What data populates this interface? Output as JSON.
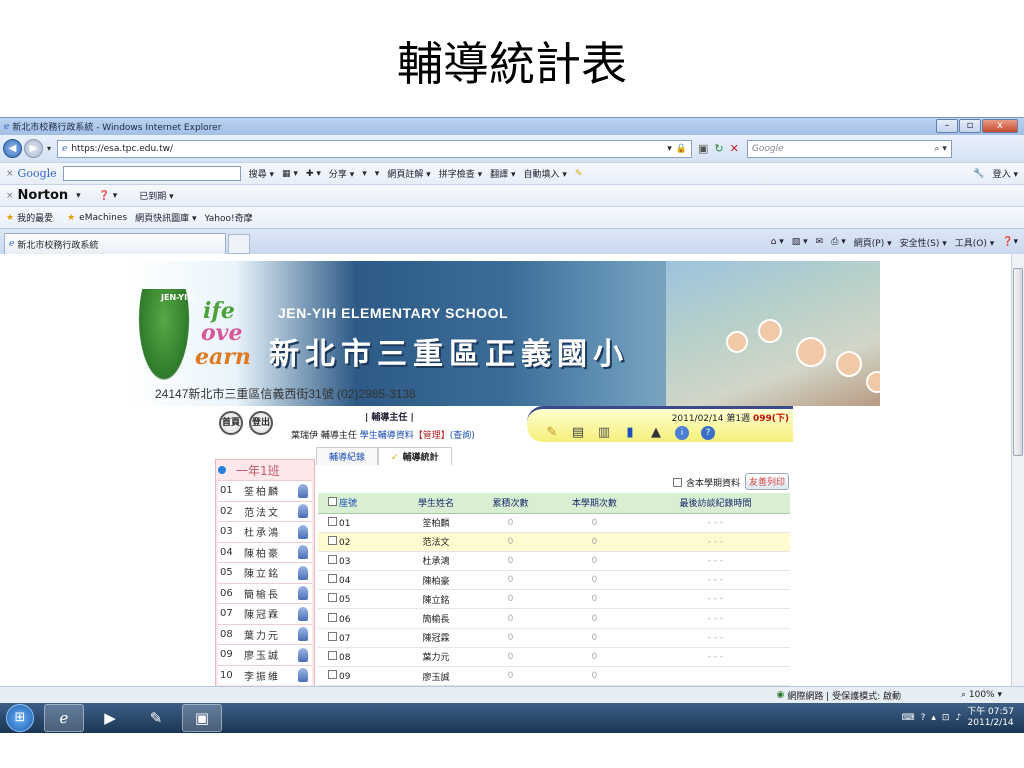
{
  "slide_title": "輔導統計表",
  "window": {
    "title": "新北市校務行政系統 - Windows Internet Explorer",
    "controls": [
      "–",
      "▫",
      "x"
    ]
  },
  "address": {
    "url": "https://esa.tpc.edu.tw/",
    "search_placeholder": "Google"
  },
  "google_toolbar": {
    "label": "Google",
    "items": [
      "搜尋 ▾",
      "▦ ▾",
      "✚ ▾",
      "分享 ▾",
      "▾",
      "▾",
      "網頁註解 ▾",
      "拼字檢查 ▾",
      "翻譯 ▾",
      "自動填入 ▾"
    ],
    "login": "登入 ▾"
  },
  "norton_toolbar": {
    "label": "Norton",
    "expired": "已到期 ▾"
  },
  "favorites": {
    "items": [
      "我的最愛",
      "eMachines",
      "網頁快訊圖庫 ▾",
      "Yahoo!奇摩"
    ]
  },
  "tab": {
    "title": "新北市校務行政系統"
  },
  "commands": [
    "▾",
    "▾",
    "▾",
    "網頁(P) ▾",
    "安全性(S) ▾",
    "工具(O) ▾",
    "▾"
  ],
  "banner": {
    "jen_yih": "JEN-YIH",
    "life_words": [
      "ife",
      "ove",
      "earn"
    ],
    "school_en": "JEN-YIH ELEMENTARY SCHOOL",
    "school_zh": "新北市三重區正義國小",
    "address": "24147新北市三重區信義西街31號 (02)2985-3138"
  },
  "header": {
    "home": "首頁",
    "logout": "登出",
    "role": "| 輔導主任 |",
    "user_prefix": "葉瑞伊 輔導主任",
    "link_data": "學生輔導資料",
    "link_manage": "【管理】",
    "link_query": "(查詢)",
    "date": "2011/02/14 第1週",
    "week": "099(下)"
  },
  "tabs": {
    "record": "輔導紀錄",
    "check": "✓",
    "stats": "輔導統計"
  },
  "class_list": {
    "title": "一年1班",
    "students": [
      {
        "no": "01",
        "name": "筌柏麟"
      },
      {
        "no": "02",
        "name": "范法文"
      },
      {
        "no": "03",
        "name": "杜承鴻"
      },
      {
        "no": "04",
        "name": "陳柏豪"
      },
      {
        "no": "05",
        "name": "陳立銘"
      },
      {
        "no": "06",
        "name": "簡榆長"
      },
      {
        "no": "07",
        "name": "陳冠霖"
      },
      {
        "no": "08",
        "name": "葉力元"
      },
      {
        "no": "09",
        "name": "廖玉誠"
      },
      {
        "no": "10",
        "name": "李振維"
      }
    ]
  },
  "table": {
    "semester_label": "含本學期資料",
    "print_label": "友善列印",
    "headers": [
      "座號",
      "學生姓名",
      "累積次數",
      "本學期次數",
      "最後訪談紀錄時間"
    ],
    "rows": [
      {
        "seat": "01",
        "name": "筌柏麟",
        "total": "0",
        "term": "0",
        "last": "- - -"
      },
      {
        "seat": "02",
        "name": "范法文",
        "total": "0",
        "term": "0",
        "last": "- - -"
      },
      {
        "seat": "03",
        "name": "杜承鴻",
        "total": "0",
        "term": "0",
        "last": "- - -"
      },
      {
        "seat": "04",
        "name": "陳柏豪",
        "total": "0",
        "term": "0",
        "last": "- - -"
      },
      {
        "seat": "05",
        "name": "陳立銘",
        "total": "0",
        "term": "0",
        "last": "- - -"
      },
      {
        "seat": "06",
        "name": "簡榆長",
        "total": "0",
        "term": "0",
        "last": "- - -"
      },
      {
        "seat": "07",
        "name": "陳冠霖",
        "total": "0",
        "term": "0",
        "last": "- - -"
      },
      {
        "seat": "08",
        "name": "葉力元",
        "total": "0",
        "term": "0",
        "last": "- - -"
      },
      {
        "seat": "09",
        "name": "廖玉誠",
        "total": "0",
        "term": "0",
        "last": ""
      }
    ]
  },
  "status": {
    "zone": "網際網路 | 受保護模式: 啟動",
    "zoom": "100%"
  },
  "clock": {
    "time": "下午 07:57",
    "date": "2011/2/14"
  }
}
